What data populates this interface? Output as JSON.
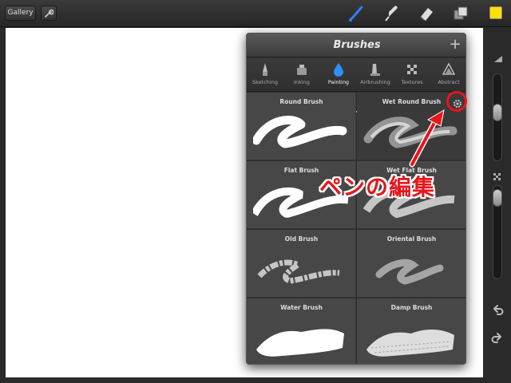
{
  "toolbar": {
    "gallery_label": "Gallery",
    "tools": [
      "brush-tool",
      "smudge-tool",
      "eraser-tool",
      "layers-tool"
    ],
    "current_color": "#ffe000"
  },
  "brushes_panel": {
    "title": "Brushes",
    "add_label": "+",
    "categories": [
      {
        "label": "Sketching",
        "icon": "pencil-icon"
      },
      {
        "label": "Inking",
        "icon": "ink-pot-icon"
      },
      {
        "label": "Painting",
        "icon": "paint-drop-icon",
        "active": true
      },
      {
        "label": "Airbrushing",
        "icon": "airbrush-icon"
      },
      {
        "label": "Textures",
        "icon": "texture-icon"
      },
      {
        "label": "Abstract",
        "icon": "abstract-icon"
      }
    ],
    "brushes": [
      {
        "label": "Round Brush"
      },
      {
        "label": "Wet Round Brush",
        "selected": true
      },
      {
        "label": "Flat Brush"
      },
      {
        "label": "Wet Flat Brush"
      },
      {
        "label": "Old Brush"
      },
      {
        "label": "Oriental Brush"
      },
      {
        "label": "Water Brush"
      },
      {
        "label": "Damp Brush"
      }
    ]
  },
  "annotation": {
    "text": "ペンの編集",
    "color": "#e8151b"
  }
}
